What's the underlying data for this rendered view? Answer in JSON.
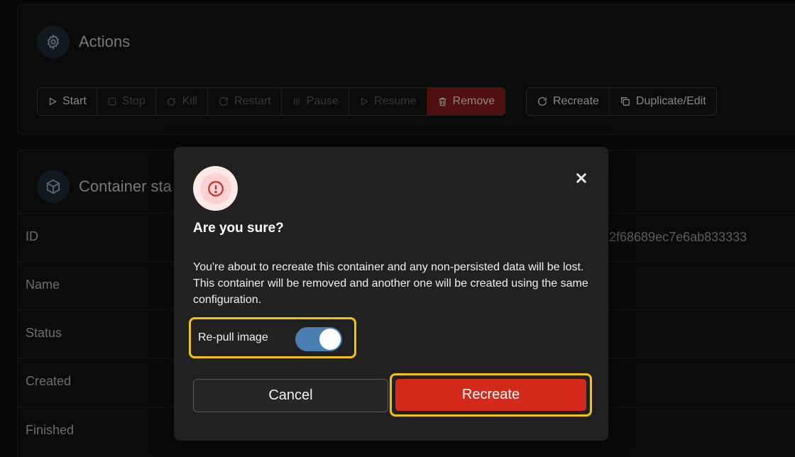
{
  "actions": {
    "title": "Actions",
    "icon": "gear-icon",
    "buttons": [
      {
        "label": "Start",
        "icon": "play-icon",
        "enabled": true
      },
      {
        "label": "Stop",
        "icon": "square-icon",
        "enabled": false
      },
      {
        "label": "Kill",
        "icon": "bomb-icon",
        "enabled": false
      },
      {
        "label": "Restart",
        "icon": "refresh-icon",
        "enabled": false
      },
      {
        "label": "Pause",
        "icon": "pause-icon",
        "enabled": false
      },
      {
        "label": "Resume",
        "icon": "play-icon",
        "enabled": false
      },
      {
        "label": "Remove",
        "icon": "trash-icon",
        "enabled": true
      }
    ],
    "secondary_buttons": [
      {
        "label": "Recreate",
        "icon": "refresh-icon"
      },
      {
        "label": "Duplicate/Edit",
        "icon": "copy-icon"
      }
    ]
  },
  "container_status": {
    "title": "Container sta",
    "icon": "cube-icon",
    "rows": [
      {
        "label": "ID",
        "value": "2f68689ec7e6ab833333"
      },
      {
        "label": "Name"
      },
      {
        "label": "Status"
      },
      {
        "label": "Created"
      },
      {
        "label": "Finished"
      }
    ]
  },
  "modal": {
    "title": "Are you sure?",
    "message": "You're about to recreate this container and any non-persisted data will be lost. This container will be removed and another one will be created using the same configuration.",
    "toggle_label": "Re-pull image",
    "toggle_on": true,
    "cancel_label": "Cancel",
    "confirm_label": "Recreate",
    "accent": "#d42a1c",
    "highlight": "#f2c30b"
  }
}
